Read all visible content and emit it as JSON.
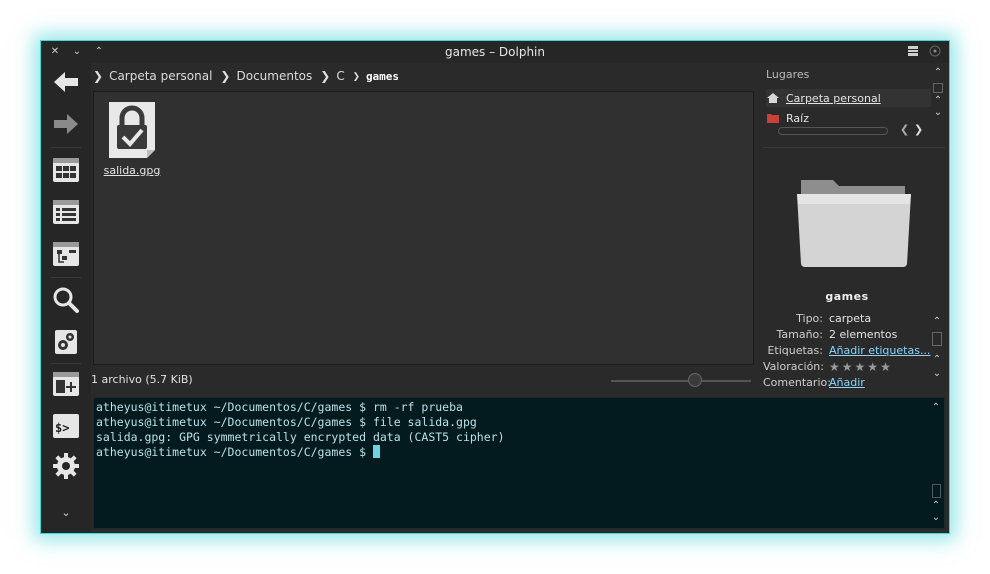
{
  "window": {
    "title": "games – Dolphin"
  },
  "breadcrumb": [
    {
      "label": "Carpeta personal"
    },
    {
      "label": "Documentos"
    },
    {
      "label": "C"
    },
    {
      "label": "games"
    }
  ],
  "file": {
    "name": "salida.gpg",
    "icon": "encrypted-file-icon"
  },
  "status": {
    "text": "1 archivo (5.7 KiB)",
    "zoom_level": 0.6
  },
  "places": {
    "title": "Lugares",
    "items": [
      {
        "label": "Carpeta personal",
        "icon": "home-icon"
      },
      {
        "label": "Raíz",
        "icon": "red-folder-icon"
      }
    ]
  },
  "info": {
    "name": "games",
    "rows": [
      {
        "label": "Tipo:",
        "value": "carpeta"
      },
      {
        "label": "Tamaño:",
        "value": "2 elementos"
      },
      {
        "label": "Etiquetas:",
        "value": "Añadir etiquetas..."
      },
      {
        "label": "Valoración:",
        "value": ""
      },
      {
        "label": "Comentario:",
        "value": "Añadir"
      }
    ],
    "rating": 0
  },
  "terminal": {
    "lines": [
      "atheyus@itimetux ~/Documentos/C/games $ rm -rf prueba",
      "atheyus@itimetux ~/Documentos/C/games $ file salida.gpg",
      "salida.gpg: GPG symmetrically encrypted data (CAST5 cipher)",
      "atheyus@itimetux ~/Documentos/C/games $ "
    ]
  },
  "colors": {
    "accent": "#3fd6d6",
    "terminal_bg": "#031a1e",
    "terminal_fg": "#b9e2e6"
  }
}
